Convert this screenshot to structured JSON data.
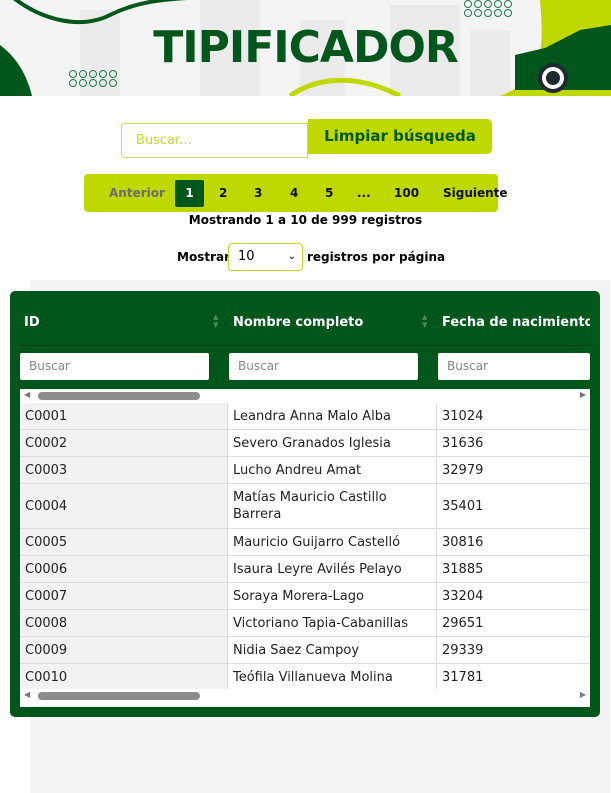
{
  "header": {
    "title": "TIPIFICADOR"
  },
  "search": {
    "placeholder": "Buscar...",
    "clear_label": "Limpiar búsqueda"
  },
  "pagination": {
    "prev": "Anterior",
    "pages": [
      "1",
      "2",
      "3",
      "4",
      "5",
      "...",
      "100"
    ],
    "current": "1",
    "next": "Siguiente"
  },
  "info": "Mostrando 1 a 10 de 999 registros",
  "length": {
    "prefix": "Mostrar",
    "value": "10",
    "suffix": "registros por página"
  },
  "table": {
    "columns": [
      "ID",
      "Nombre completo",
      "Fecha de nacimiento"
    ],
    "filter_placeholder": "Buscar",
    "rows": [
      [
        "C0001",
        "Leandra Anna Malo Alba",
        "31024"
      ],
      [
        "C0002",
        "Severo Granados Iglesia",
        "31636"
      ],
      [
        "C0003",
        "Lucho Andreu Amat",
        "32979"
      ],
      [
        "C0004",
        "Matías Mauricio Castillo Barrera",
        "35401"
      ],
      [
        "C0005",
        "Mauricio Guijarro Castelló",
        "30816"
      ],
      [
        "C0006",
        "Isaura Leyre Avilés Pelayo",
        "31885"
      ],
      [
        "C0007",
        "Soraya Morera-Lago",
        "33204"
      ],
      [
        "C0008",
        "Victoriano Tapia-Cabanillas",
        "29651"
      ],
      [
        "C0009",
        "Nidia Saez Campoy",
        "29339"
      ],
      [
        "C0010",
        "Teófila Villanueva Molina",
        "31781"
      ]
    ]
  },
  "colors": {
    "primary": "#00561b",
    "accent": "#bfd900"
  }
}
